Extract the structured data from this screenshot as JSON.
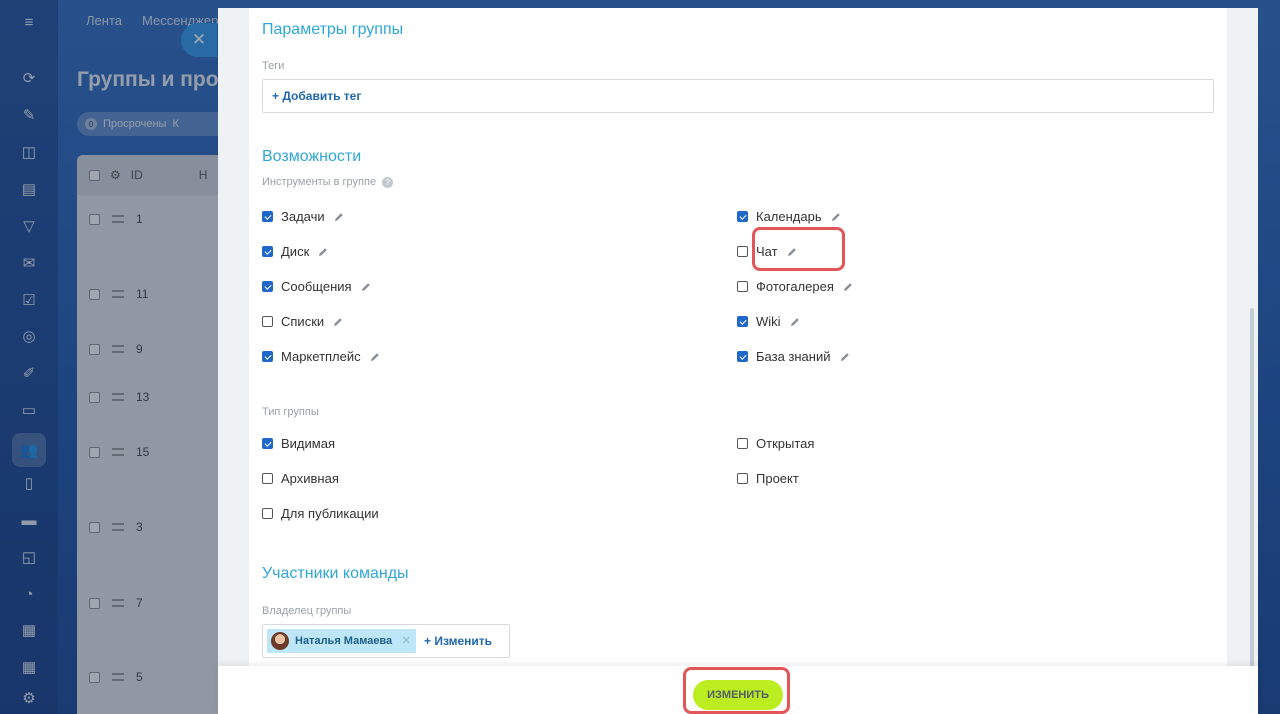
{
  "background": {
    "nav": [
      "Лента",
      "Мессенджер"
    ],
    "title": "Группы и про",
    "filter": {
      "count": "0",
      "label": "Просрочены",
      "extra": "К"
    },
    "table": {
      "id_header": "ID",
      "extra_header": "Н",
      "row_ids": [
        "1",
        "11",
        "9",
        "13",
        "15",
        "3",
        "7",
        "5"
      ]
    },
    "rail_icons": [
      "menu-icon",
      "activity-icon",
      "edit-doc-icon",
      "camera-icon",
      "report-icon",
      "filter-icon",
      "mail-icon",
      "check-icon",
      "target-icon",
      "pen-icon",
      "id-card-icon",
      "users-icon",
      "document-icon",
      "card-icon",
      "chat-icon",
      "robot-icon",
      "calendar-icon",
      "calendar2-icon",
      "settings-icon"
    ]
  },
  "panel": {
    "params_title": "Параметры группы",
    "tags_label": "Теги",
    "add_tag": "+ Добавить тег",
    "features_title": "Возможности",
    "tools_label": "Инструменты в группе",
    "tools_left": [
      {
        "label": "Задачи",
        "checked": true
      },
      {
        "label": "Диск",
        "checked": true
      },
      {
        "label": "Сообщения",
        "checked": true
      },
      {
        "label": "Списки",
        "checked": false
      },
      {
        "label": "Маркетплейс",
        "checked": true
      }
    ],
    "tools_right": [
      {
        "label": "Календарь",
        "checked": true
      },
      {
        "label": "Чат",
        "checked": false
      },
      {
        "label": "Фотогалерея",
        "checked": false
      },
      {
        "label": "Wiki",
        "checked": true
      },
      {
        "label": "База знаний",
        "checked": true
      }
    ],
    "type_label": "Тип группы",
    "types_left": [
      {
        "label": "Видимая",
        "checked": true
      },
      {
        "label": "Архивная",
        "checked": false
      },
      {
        "label": "Для публикации",
        "checked": false
      }
    ],
    "types_right": [
      {
        "label": "Открытая",
        "checked": false
      },
      {
        "label": "Проект",
        "checked": false
      }
    ],
    "team_title": "Участники команды",
    "owner_label": "Владелец группы",
    "owner_name": "Наталья Мамаева",
    "owner_change": "+ Изменить"
  },
  "footer": {
    "save_label": "ИЗМЕНИТЬ"
  },
  "colors": {
    "accent": "#2fa7d8",
    "checkbox": "#2068c8",
    "save": "#bbed21",
    "highlight": "#e25659"
  }
}
